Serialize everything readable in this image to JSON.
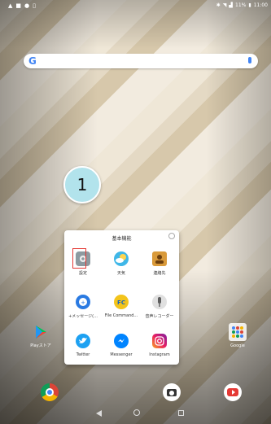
{
  "status_bar": {
    "left_icons": [
      "alert-icon",
      "image-icon",
      "lock-icon",
      "doc-icon"
    ],
    "right_text": "11%",
    "time": "11:00"
  },
  "search_bar": {
    "logo_letter": "G"
  },
  "step_badge": {
    "number": "1"
  },
  "folder": {
    "title": "基本機能",
    "apps": [
      {
        "label": "設定",
        "icon": "gear-icon",
        "color": "#8d9aa0"
      },
      {
        "label": "天気",
        "icon": "weather-icon",
        "color": "#3fb7e8"
      },
      {
        "label": "連絡先",
        "icon": "contacts-icon",
        "color": "#d99a3a"
      },
      {
        "label": "+メッセージ(...",
        "icon": "message-plus-icon",
        "color": "#2a7ae2"
      },
      {
        "label": "File Command...",
        "icon": "file-commander-icon",
        "color": "#f3c41b"
      },
      {
        "label": "音声レコーダー",
        "icon": "microphone-icon",
        "color": "#5d5d5d"
      },
      {
        "label": "Twitter",
        "icon": "twitter-icon",
        "color": "#1da1f2"
      },
      {
        "label": "Messenger",
        "icon": "messenger-icon",
        "color": "#0084ff"
      },
      {
        "label": "Instagram",
        "icon": "instagram-icon",
        "color": "#c13584"
      }
    ]
  },
  "desktop": {
    "play_store_label": "Playストア",
    "google_folder_label": "Google"
  },
  "dock": [
    "chrome-icon",
    "camera-icon",
    "youtube-icon"
  ],
  "nav": [
    "back-icon",
    "home-icon",
    "recents-icon"
  ]
}
